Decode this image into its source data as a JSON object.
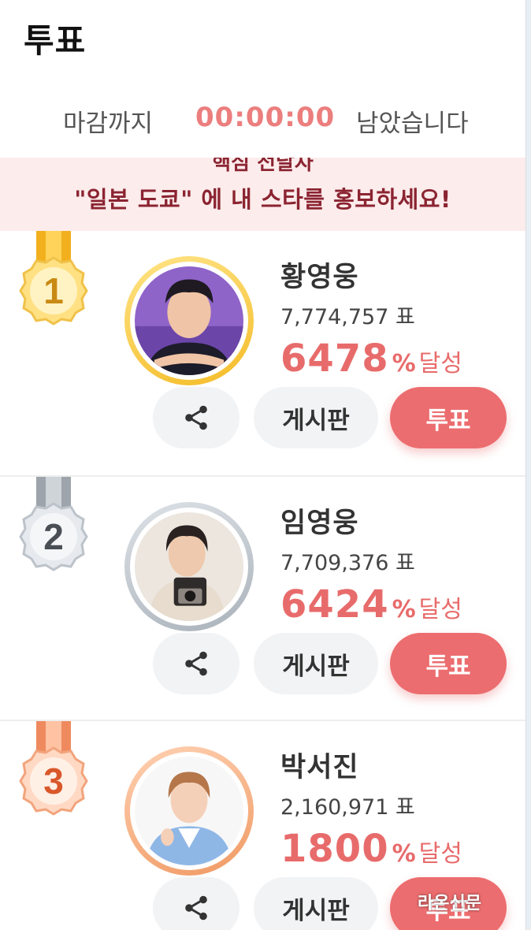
{
  "header": {
    "title": "투표",
    "deadline_before": "마감까지",
    "timer": "00:00:00",
    "deadline_after": "남았습니다"
  },
  "banner": {
    "line1": "핵심 전달자",
    "line2": "\"일본 도쿄\" 에 내 스타를 홍보하세요!"
  },
  "ranks": [
    {
      "rank": "1",
      "name": "황영웅",
      "votes": "7,774,757 표",
      "percent": "6478",
      "percent_unit": "%",
      "percent_text": "달성",
      "board_label": "게시판",
      "vote_label": "투표",
      "medal_color": "#f4c430"
    },
    {
      "rank": "2",
      "name": "임영웅",
      "votes": "7,709,376 표",
      "percent": "6424",
      "percent_unit": "%",
      "percent_text": "달성",
      "board_label": "게시판",
      "vote_label": "투표",
      "medal_color": "#c7cdd3"
    },
    {
      "rank": "3",
      "name": "박서진",
      "votes": "2,160,971 표",
      "percent": "1800",
      "percent_unit": "%",
      "percent_text": "달성",
      "board_label": "게시판",
      "vote_label": "투표",
      "medal_color": "#f4a27a"
    }
  ],
  "watermark": "라온신문",
  "colors": {
    "accent": "#ec6d6f",
    "timer": "#ec7e7e",
    "banner_bg": "#fcecec",
    "banner_text": "#8b2431"
  }
}
